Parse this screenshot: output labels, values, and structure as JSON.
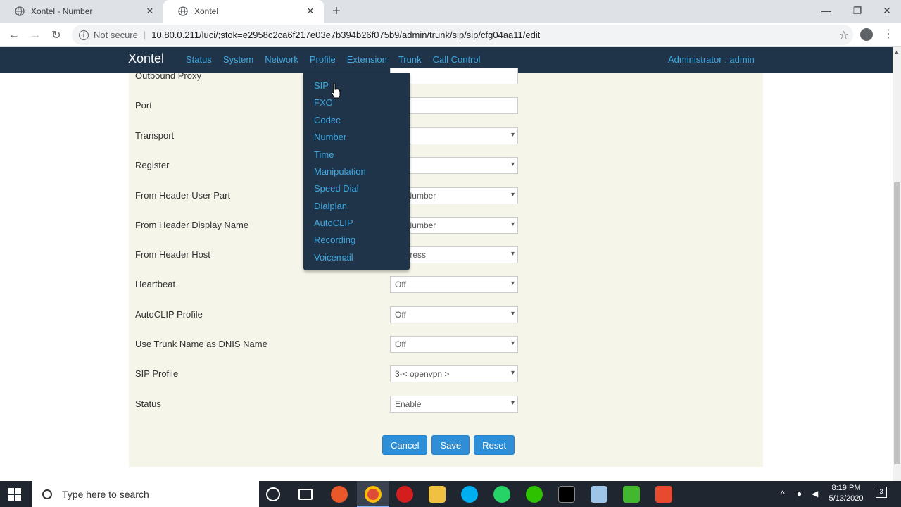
{
  "browser": {
    "tabs": [
      {
        "title": "Xontel - Number",
        "active": false
      },
      {
        "title": "Xontel",
        "active": true
      }
    ],
    "new_tab": "+",
    "omnibox": {
      "security": "Not secure",
      "separator": "|",
      "url": "10.80.0.211/luci/;stok=e2958c2ca6f217e03e7b394b26f075b9/admin/trunk/sip/sip/cfg04aa11/edit"
    }
  },
  "app": {
    "brand": "Xontel",
    "menu": [
      "Status",
      "System",
      "Network",
      "Profile",
      "Extension",
      "Trunk",
      "Call Control"
    ],
    "user": "Administrator : admin"
  },
  "profile_dropdown": {
    "items": [
      "SIP",
      "FXO",
      "Codec",
      "Number",
      "Time",
      "Manipulation",
      "Speed Dial",
      "Dialplan",
      "AutoCLIP",
      "Recording",
      "Voicemail"
    ]
  },
  "form": {
    "rows": [
      {
        "label": "Outbound Proxy",
        "value": "",
        "type": "text"
      },
      {
        "label": "Port",
        "value": "",
        "type": "text"
      },
      {
        "label": "Transport",
        "value": "",
        "type": "select"
      },
      {
        "label": "Register",
        "value": "",
        "type": "select"
      },
      {
        "label": "From Header User Part",
        "value": "r's Number",
        "type": "select"
      },
      {
        "label": "From Header Display Name",
        "value": "r's Number",
        "type": "select"
      },
      {
        "label": "From Header Host",
        "value": "Address",
        "type": "select"
      },
      {
        "label": "Heartbeat",
        "value": "Off",
        "type": "select"
      },
      {
        "label": "AutoCLIP Profile",
        "value": "Off",
        "type": "select"
      },
      {
        "label": "Use Trunk Name as DNIS Name",
        "value": "Off",
        "type": "select"
      },
      {
        "label": "SIP Profile",
        "value": "3-< openvpn >",
        "type": "select"
      },
      {
        "label": "Status",
        "value": "Enable",
        "type": "select"
      }
    ],
    "buttons": {
      "cancel": "Cancel",
      "save": "Save",
      "reset": "Reset"
    }
  },
  "taskbar": {
    "search_placeholder": "Type here to search",
    "time": "8:19 PM",
    "date": "5/13/2020",
    "notification_count": "3"
  }
}
